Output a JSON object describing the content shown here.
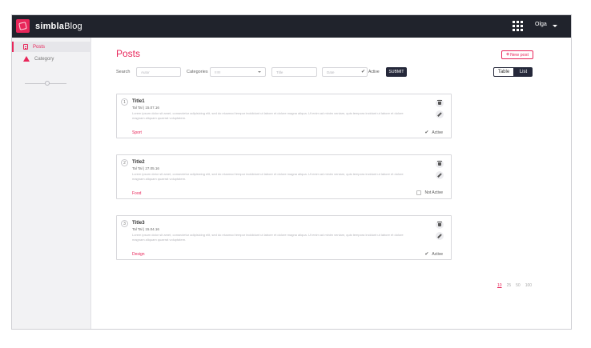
{
  "app": {
    "brand_bold": "simbla",
    "brand_light": "Blog",
    "user_name": "Olga"
  },
  "sidebar": {
    "items": [
      {
        "label": "Posts",
        "icon": "page-icon",
        "active": true
      },
      {
        "label": "Category",
        "icon": "triangle-icon",
        "active": false
      }
    ]
  },
  "main": {
    "title": "Posts",
    "new_post_label": "New post",
    "new_post_plus": "+"
  },
  "filters": {
    "search_label": "Search",
    "author_placeholder": "Autor",
    "categories_label": "Categories",
    "categories_value": "!!!!!!",
    "title_placeholder": "Title",
    "date_placeholder": "Date",
    "active_label": "Active",
    "active_check": "✔",
    "submit_label": "SUBMIT"
  },
  "view_toggle": {
    "table_label": "Table",
    "list_label": "List",
    "selected": "List"
  },
  "posts": [
    {
      "number": "1",
      "title": "Title1",
      "meta": "Tal Tal | 15.07.16",
      "body": "Lorem ipsum dolor sit amet, consectetur adipisicing elit, sed do eiusmod tempor incididunt ut labore et dolore magna aliqua. Ut enim ad minim veniam, quis tempora incidunt ut labore et dolore magnam aliquam quaerat voluptatem.",
      "category": "Sport",
      "status": "Active",
      "active": true
    },
    {
      "number": "2",
      "title": "Title2",
      "meta": "Tal Tal | 27.05.16",
      "body": "Lorem ipsum dolor sit amet, consectetur adipisicing elit, sed do eiusmod tempor incididunt ut labore et dolore magna aliqua. Ut enim ad minim veniam, quis tempora incidunt ut labore et dolore magnam aliquam quaerat voluptatem.",
      "category": "Food",
      "status": "Not Active",
      "active": false
    },
    {
      "number": "3",
      "title": "Title3",
      "meta": "Tal Tal | 15.04.16",
      "body": "Lorem ipsum dolor sit amet, consectetur adipisicing elit, sed do eiusmod tempor incididunt ut labore et dolore magna aliqua. Ut enim ad minim veniam, quis tempora incidunt ut labore et dolore magnam aliquam quaerat voluptatem.",
      "category": "Design",
      "status": "Active",
      "active": true
    }
  ],
  "pagination": {
    "sizes": [
      "10",
      "25",
      "50",
      "100"
    ],
    "current": "10"
  },
  "colors": {
    "accent": "#e8265a",
    "topbar": "#20232c",
    "dark_button": "#25283a",
    "sidebar_bg": "#f2f2f4"
  }
}
